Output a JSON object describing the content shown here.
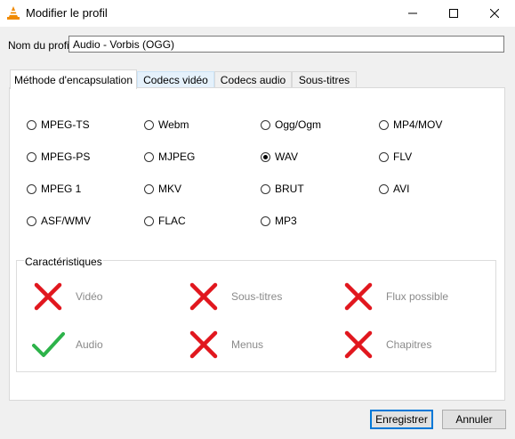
{
  "window": {
    "title": "Modifier le profil"
  },
  "profile": {
    "label": "Nom du profil",
    "value": "Audio - Vorbis (OGG)"
  },
  "tabs": [
    {
      "label": "Méthode d'encapsulation"
    },
    {
      "label": "Codecs vidéo"
    },
    {
      "label": "Codecs audio"
    },
    {
      "label": "Sous-titres"
    }
  ],
  "encapsulation": {
    "options": [
      "MPEG-TS",
      "Webm",
      "Ogg/Ogm",
      "MP4/MOV",
      "MPEG-PS",
      "MJPEG",
      "WAV",
      "FLV",
      "MPEG 1",
      "MKV",
      "BRUT",
      "AVI",
      "ASF/WMV",
      "FLAC",
      "MP3"
    ],
    "selected": "WAV"
  },
  "features": {
    "title": "Caractéristiques",
    "items": [
      {
        "label": "Vidéo",
        "enabled": false
      },
      {
        "label": "Sous-titres",
        "enabled": false
      },
      {
        "label": "Flux possible",
        "enabled": false
      },
      {
        "label": "Audio",
        "enabled": true
      },
      {
        "label": "Menus",
        "enabled": false
      },
      {
        "label": "Chapitres",
        "enabled": false
      }
    ]
  },
  "buttons": {
    "save": "Enregistrer",
    "cancel": "Annuler"
  },
  "colors": {
    "check": "#2db34a",
    "cross": "#e1171e",
    "accent": "#0078d7"
  }
}
